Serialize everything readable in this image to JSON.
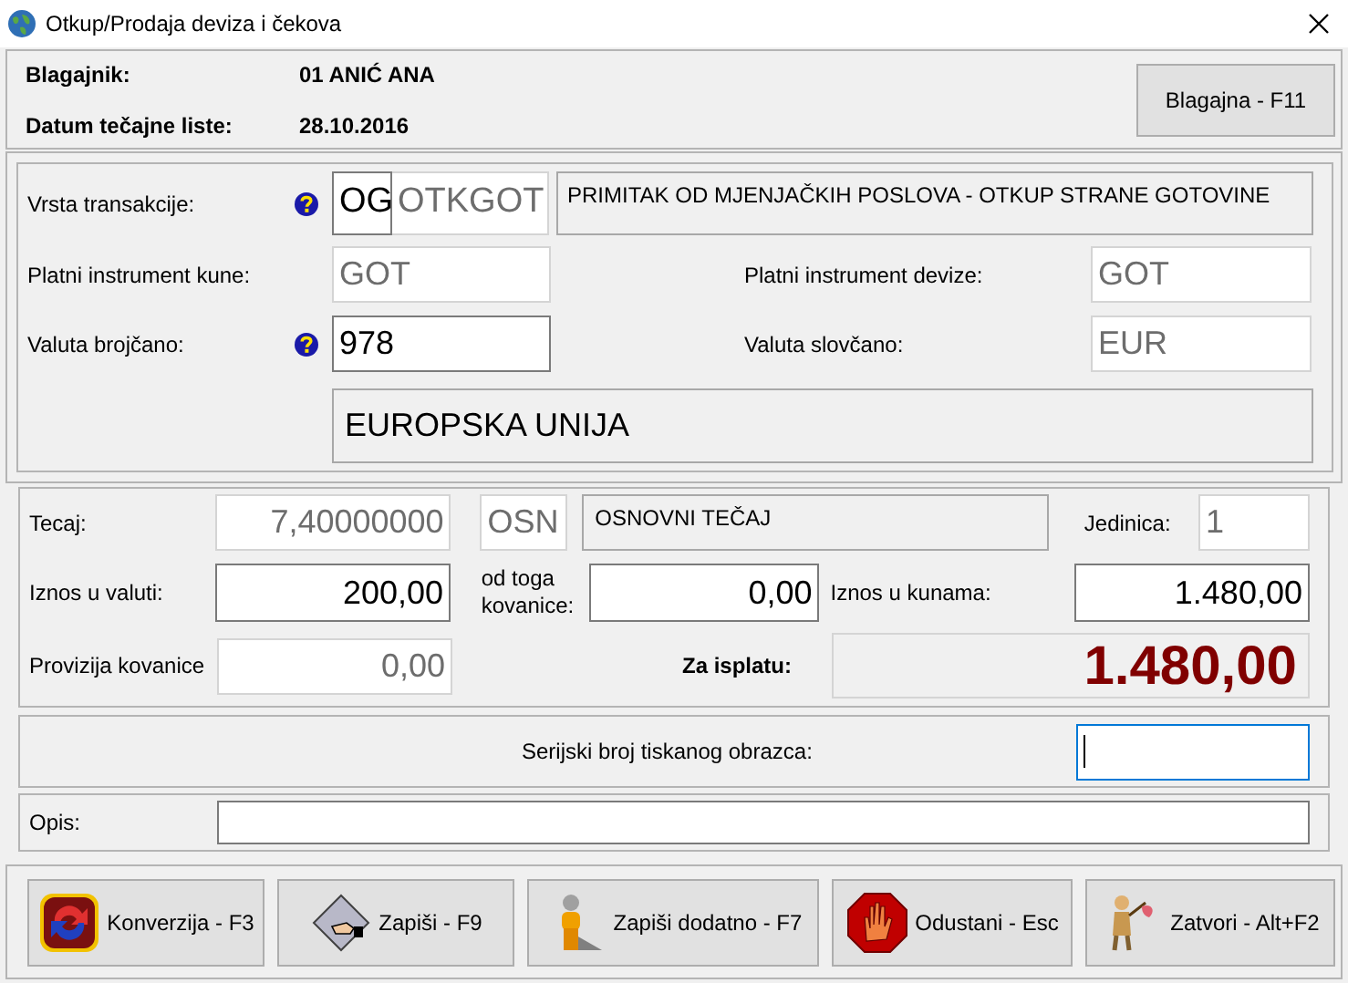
{
  "window": {
    "title": "Otkup/Prodaja deviza i čekova"
  },
  "header": {
    "cashier_label": "Blagajnik:",
    "cashier": "01 ANIĆ ANA",
    "date_label": "Datum tečajne liste:",
    "date": "28.10.2016",
    "button": "Blagajna - F11"
  },
  "transaction": {
    "type": {
      "label": "Vrsta transakcije:",
      "help": true,
      "code": {
        "value": "OG",
        "kind": "editable"
      },
      "name": {
        "value": "OTKGOT",
        "kind": "readonly"
      },
      "description": "PRIMITAK OD MJENJAČKIH POSLOVA - OTKUP STRANE GOTOVINE"
    },
    "payment_kune": {
      "label": "Platni instrument kune:",
      "value": "GOT",
      "kind": "readonly"
    },
    "payment_foreign": {
      "label": "Platni instrument devize:",
      "value": "GOT",
      "kind": "readonly"
    },
    "currency_code": {
      "label": "Valuta brojčano:",
      "help": true,
      "value": "978",
      "kind": "editable"
    },
    "currency_symbol": {
      "label": "Valuta slovčano:",
      "value": "EUR",
      "kind": "readonly"
    },
    "currency_name": "EUROPSKA UNIJA"
  },
  "rates": {
    "rate": {
      "label": "Tecaj:",
      "value": "7,40000000",
      "kind": "readonly"
    },
    "rate_code": {
      "value": "OSN",
      "kind": "readonly"
    },
    "rate_description": "OSNOVNI TEČAJ",
    "unit": {
      "label": "Jedinica:",
      "value": "1",
      "kind": "readonly"
    },
    "amount": {
      "label": "Iznos u valuti:",
      "value": "200,00",
      "kind": "editable"
    },
    "coins": {
      "label": "od toga kovanice:",
      "value": "0,00",
      "kind": "editable"
    },
    "amount_kn": {
      "label": "Iznos u kunama:",
      "value": "1.480,00",
      "kind": "editable"
    },
    "coin_fee": {
      "label": "Provizija kovanice",
      "value": "0,00",
      "kind": "readonly"
    },
    "payout": {
      "label": "Za isplatu:",
      "value": "1.480,00"
    }
  },
  "serial": {
    "label": "Serijski broj tiskanog obrazca:",
    "kind": "focused"
  },
  "note": {
    "label": "Opis:",
    "kind": "editable"
  },
  "buttons": [
    {
      "label": "Konverzija - F3"
    },
    {
      "label": "Zapiši - F9"
    },
    {
      "label": "Zapiši dodatno - F7"
    },
    {
      "label": "Odustani - Esc"
    },
    {
      "label": "Zatvori - Alt+F2"
    }
  ]
}
